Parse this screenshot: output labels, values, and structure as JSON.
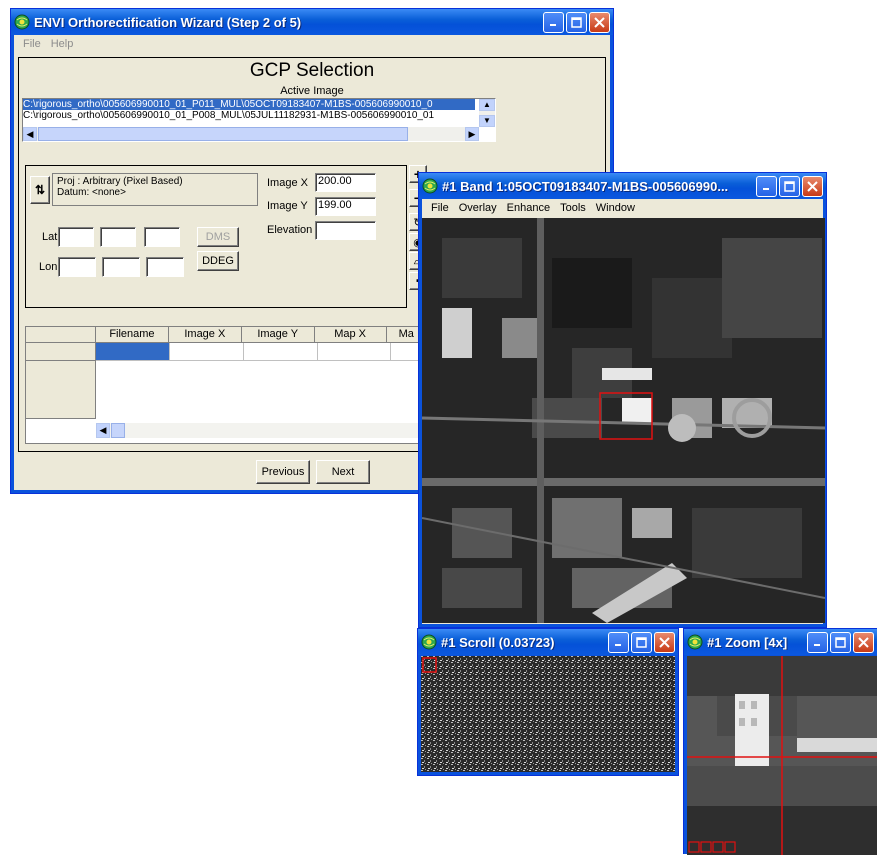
{
  "wizard": {
    "title": "ENVI Orthorectification Wizard (Step 2 of 5)",
    "menu": [
      "File",
      "Help"
    ],
    "heading": "GCP Selection",
    "active_image_label": "Active Image",
    "files": [
      "C:\\rigorous_ortho\\005606990010_01_P011_MUL\\05OCT09183407-M1BS-005606990010_0",
      "C:\\rigorous_ortho\\005606990010_01_P008_MUL\\05JUL11182931-M1BS-005606990010_01"
    ],
    "proj_text": "Proj : Arbitrary (Pixel Based)",
    "datum_text": "Datum: <none>",
    "image_x_label": "Image X",
    "image_x_value": "200.00",
    "image_y_label": "Image Y",
    "image_y_value": "199.00",
    "elevation_label": "Elevation",
    "elevation_value": "",
    "lat_label": "Lat",
    "lon_label": "Lon",
    "dms_label": "DMS",
    "ddeg_label": "DDEG",
    "table_headers": [
      "Filename",
      "Image X",
      "Image Y",
      "Map X",
      "Ma"
    ],
    "previous_label": "Previous",
    "next_label": "Next"
  },
  "band": {
    "title": "#1 Band 1:05OCT09183407-M1BS-005606990...",
    "menu": [
      "File",
      "Overlay",
      "Enhance",
      "Tools",
      "Window"
    ]
  },
  "scroll": {
    "title": "#1 Scroll (0.03723)"
  },
  "zoom": {
    "title": "#1 Zoom [4x]"
  },
  "colors": {
    "title_blue": "#0a5fd8",
    "dialog_bg": "#ece9d8",
    "selection": "#316ac5",
    "roi_red": "#e01010"
  }
}
